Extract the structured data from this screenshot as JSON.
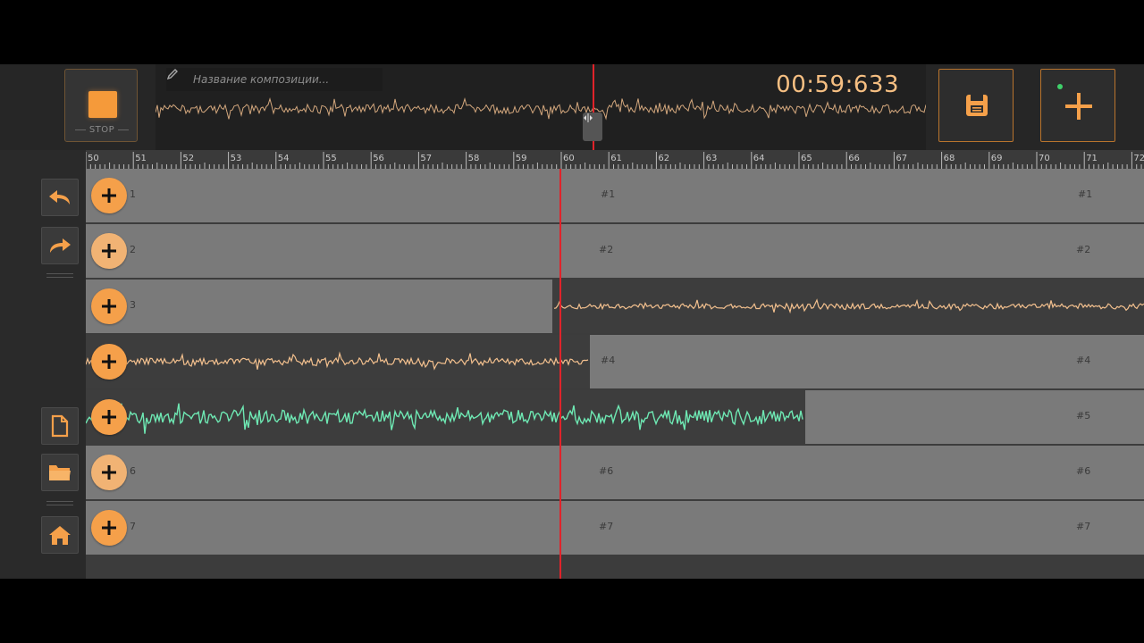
{
  "header": {
    "stop_label": "STOP",
    "title_placeholder": "Название композиции...",
    "time": "00:59:633"
  },
  "icons": {
    "stop": "stop-square-icon",
    "pencil": "pencil-icon",
    "save": "floppy-disk-icon",
    "add": "plus-icon",
    "undo": "undo-arrow-icon",
    "redo": "redo-arrow-icon",
    "new_file": "file-icon",
    "open": "folder-icon",
    "home": "home-icon"
  },
  "ruler": {
    "ticks": [
      "50",
      "51",
      "52",
      "53",
      "54",
      "55",
      "56",
      "57",
      "58",
      "59",
      "60",
      "61",
      "62",
      "63",
      "64",
      "65",
      "66",
      "67",
      "68",
      "69",
      "70",
      "71",
      "72"
    ]
  },
  "tracks": [
    {
      "start_label": "1",
      "mid_label": "#1",
      "end_label": "#1"
    },
    {
      "start_label": "2",
      "mid_label": "#2",
      "end_label": "#2"
    },
    {
      "start_label": "3",
      "mid_label": "",
      "end_label": ""
    },
    {
      "start_label": "",
      "mid_label": "#4",
      "end_label": "#4"
    },
    {
      "start_label": "",
      "mid_label": "",
      "end_label": "#5"
    },
    {
      "start_label": "6",
      "mid_label": "#6",
      "end_label": "#6"
    },
    {
      "start_label": "7",
      "mid_label": "#7",
      "end_label": "#7"
    }
  ],
  "colors": {
    "accent": "#f5a04a",
    "wave_orange": "#f3c08e",
    "wave_green": "#6ee8b3",
    "playhead": "#e0232a"
  }
}
